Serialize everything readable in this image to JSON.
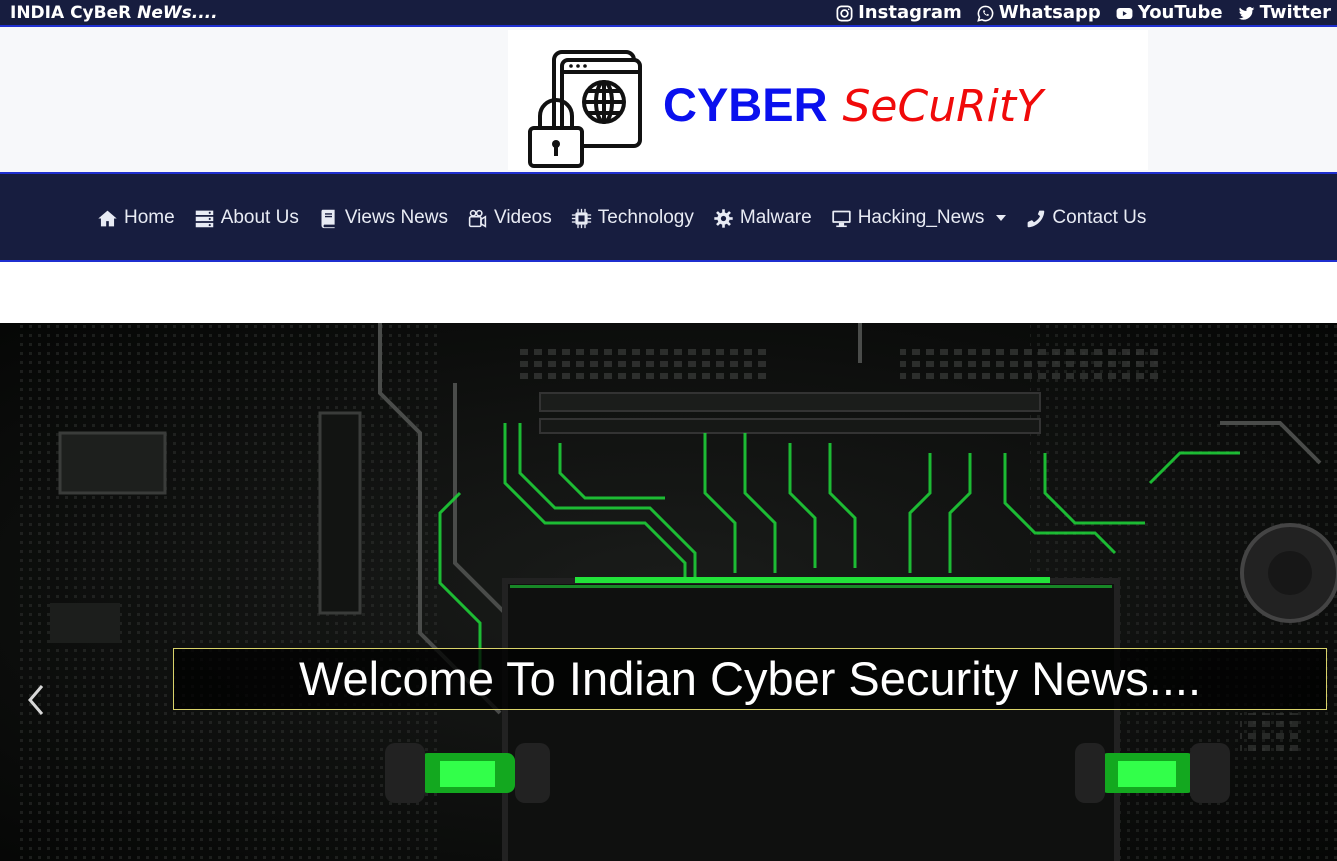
{
  "topbar": {
    "brand_main": "INDIA  CyBeR ",
    "brand_italic": "NeWs....",
    "socials": [
      {
        "label": "Instagram",
        "icon": "instagram-icon"
      },
      {
        "label": "Whatsapp",
        "icon": "whatsapp-icon"
      },
      {
        "label": "YouTube",
        "icon": "youtube-icon"
      },
      {
        "label": "Twitter",
        "icon": "twitter-icon"
      }
    ]
  },
  "header": {
    "logo_word1": "CYBER",
    "logo_word2": "SeCuRitY",
    "logo_icon": "globe-padlock-icon"
  },
  "nav": {
    "items": [
      {
        "label": "Home",
        "icon": "home-icon"
      },
      {
        "label": "About Us",
        "icon": "server-icon"
      },
      {
        "label": "Views News",
        "icon": "book-icon"
      },
      {
        "label": "Videos",
        "icon": "video-camera-icon"
      },
      {
        "label": "Technology",
        "icon": "microchip-icon"
      },
      {
        "label": "Malware",
        "icon": "gear-icon"
      },
      {
        "label": "Hacking_News",
        "icon": "desktop-icon",
        "dropdown": true
      },
      {
        "label": "Contact Us",
        "icon": "phone-icon"
      }
    ]
  },
  "hero": {
    "caption": "Welcome To Indian Cyber Security News....",
    "prev_icon": "chevron-left-icon",
    "colors": {
      "accent_green": "#22e33a",
      "caption_border": "#d9d36a"
    }
  },
  "colors": {
    "navy": "#171d3f",
    "blue_accent": "#0a10ee",
    "red_accent": "#f00a0a"
  }
}
